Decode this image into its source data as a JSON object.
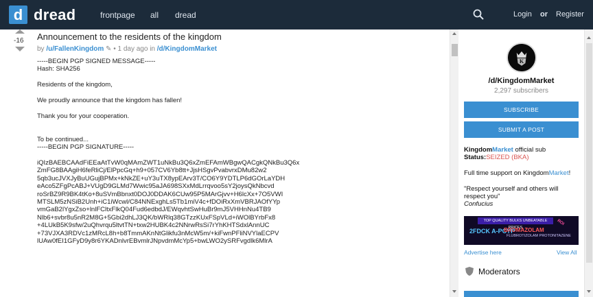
{
  "header": {
    "logo_letter": "d",
    "brand": "dread",
    "nav": [
      "frontpage",
      "all",
      "dread"
    ],
    "login": "Login",
    "or": "or",
    "register": "Register",
    "colors": {
      "bar": "#1c2b3a",
      "accent": "#3a8fd1"
    }
  },
  "post": {
    "votes": "-16",
    "title": "Announcement to the residents of the kingdom",
    "meta_by": "by",
    "author": "/u/FallenKingdom",
    "time": "1 day ago in",
    "sub": "/d/KingdomMarket",
    "body_lines": [
      "-----BEGIN PGP SIGNED MESSAGE-----",
      "Hash: SHA256",
      "",
      "Residents of the kingdom,",
      "",
      "We proudly announce that the kingdom has fallen!",
      "",
      "Thank you for your cooperation.",
      "",
      "",
      "To be continued...",
      "-----BEGIN PGP SIGNATURE-----",
      "",
      "iQIzBAEBCAAdFiEEaAtTvW0qMAmZWT1uNkBu3Q6xZmEFAmWBgwQACgkQNkBu3Q6x",
      "ZmFG8BAAgiH6feRliCj/ElPpcGq+h9+057CV6Yb8tt+JjsHSgvPvabvrxDMu82w2",
      "5qb3ucJVXJyBuUGujBPMx+kNkZE+uY3uTX8ypEArv3T/CO6Y9YDTLP6dGOrLaYDH",
      "eAco5ZFgPcABJ+VUgD9GLMd7Wwic95aJA698SXxMdLrrqvoo5sY2joysQkNbcvd",
      "roSrBZ9R9BK4tKo+8uSVmBbnxt0DOJ0DDAK6CUw95P5MArGjvv+H6lcXx+7O5VWI",
      "MTSLM5zNSiB2Unh+iC1iWcwl/C84NNExghLs5Tb1miV4c+fDOiRxXmVBRJAOfYYp",
      "vmGaB2lYgxZso+lnlFCltxFlkQ04Fud6edbdJ/EWqvhtSwHuBr9mJ5VHHnNu4TB9",
      "Nlb6+svbr8u5nR2M8G+5Gbi2dhLJ3QK/bWRlq38GTzzKUxFSpVLd+iWOlBYrbFx8",
      "+4LUkB5K9sfw/2uQhvrqu5ltvtTN+txw2HUBK4c2NNrwRsSi7rYhKHTSdxlAnnUC",
      "+73VJXA3RDVc1zMRcL8h+b8TmmAKnNtGlikfu3nMcW5m/+kiFwnPFliNVYlaECPV",
      "lUAw0fEI1GFyD9y8r6YKADnlvrEBvmlrJNpvdmMcYp5+bwLWO2ySRFvgdlk6MlrA"
    ]
  },
  "sidebar": {
    "name": "/d/KingdomMarket",
    "subscribers": "2,297 subscribers",
    "subscribe": "SUBSCRIBE",
    "submit": "SUBMIT A POST",
    "desc_name": "Kingdom",
    "desc_market": "Market",
    "desc_suffix": "official sub",
    "status_label": "Status:",
    "status_value": "SEIZED (BKA)",
    "support_prefix": "Full time support on Kingdom",
    "support_market": "Market",
    "support_suffix": "!",
    "quote": "\"Respect yourself and others will respect you\"",
    "quote_author": "Confucius",
    "banner_top": "TOP QUALITY BULKS UNBEATABLE PRICES",
    "banner_left": "2FDCK A-PCYP",
    "banner_mid": "BROMAZOLAM",
    "banner_sub": "FLUBROTIZOLAM PROTONITAZENE",
    "banner_side": "ROI",
    "advertise": "Advertise here",
    "view_all": "View All",
    "moderators": "Moderators"
  }
}
